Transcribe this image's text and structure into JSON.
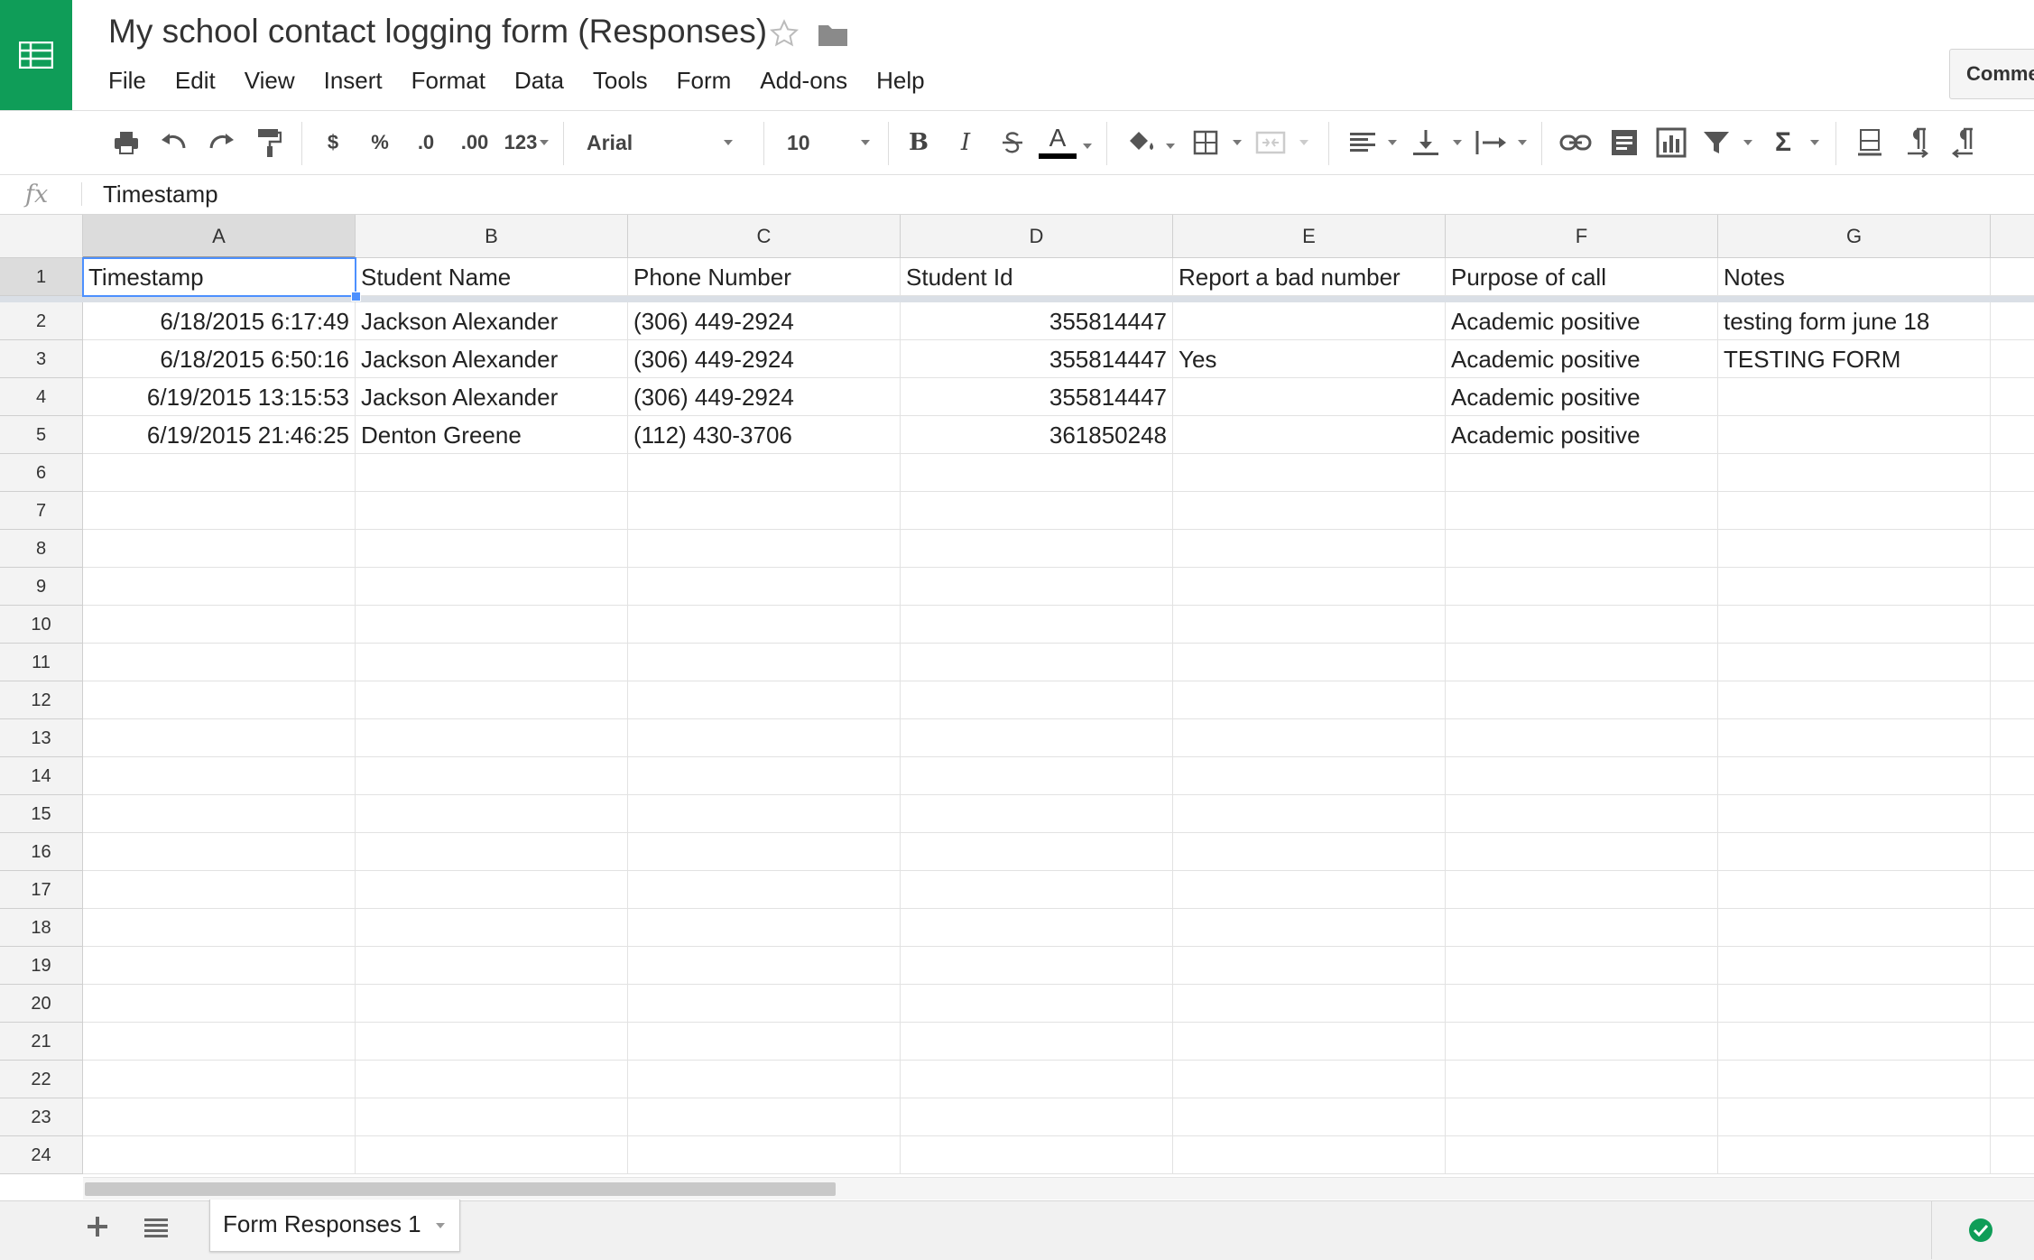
{
  "app": {
    "title": "My school contact logging form (Responses)",
    "brand_color": "#0f9d58",
    "accent_color": "#4d90fe"
  },
  "menu": [
    "File",
    "Edit",
    "View",
    "Insert",
    "Format",
    "Data",
    "Tools",
    "Form",
    "Add-ons",
    "Help"
  ],
  "header": {
    "comments_label": "Comments"
  },
  "toolbar": {
    "currency": "$",
    "percent": "%",
    "decrease_decimal": ".0",
    "increase_decimal": ".00",
    "more_formats": "123",
    "font": "Arial",
    "font_size": "10",
    "bold": "B",
    "italic": "I",
    "text_color": "A",
    "text_color_value": "#000000"
  },
  "formula_bar": {
    "fx": "fx",
    "value": "Timestamp"
  },
  "grid": {
    "columns": [
      "A",
      "B",
      "C",
      "D",
      "E",
      "F",
      "G"
    ],
    "row_numbers": [
      "1",
      "2",
      "3",
      "4",
      "5",
      "6",
      "7",
      "8",
      "9",
      "10",
      "11",
      "12",
      "13",
      "14",
      "15",
      "16",
      "17",
      "18",
      "19",
      "20",
      "21",
      "22",
      "23",
      "24"
    ],
    "header_row": [
      "Timestamp",
      "Student Name",
      "Phone Number",
      "Student Id",
      "Report a bad number",
      "Purpose of call",
      "Notes"
    ],
    "rows": [
      [
        "6/18/2015 6:17:49",
        "Jackson Alexander",
        "(306) 449-2924",
        "355814447",
        "",
        "Academic positive",
        "testing form june 18"
      ],
      [
        "6/18/2015 6:50:16",
        "Jackson Alexander",
        "(306) 449-2924",
        "355814447",
        "Yes",
        "Academic positive",
        "TESTING FORM"
      ],
      [
        "6/19/2015 13:15:53",
        "Jackson Alexander",
        "(306) 449-2924",
        "355814447",
        "",
        "Academic positive",
        ""
      ],
      [
        "6/19/2015 21:46:25",
        "Denton Greene",
        "(112) 430-3706",
        "361850248",
        "",
        "Academic positive",
        ""
      ]
    ],
    "selected_cell": "A1"
  },
  "sheets": {
    "tabs": [
      "Form Responses 1"
    ],
    "active": "Form Responses 1"
  },
  "icons": {
    "logo": "sheets-logo-icon",
    "star": "star-icon",
    "folder": "folder-icon",
    "add_sheet": "plus-icon",
    "all_sheets": "list-icon",
    "saved": "check-circle-icon"
  }
}
